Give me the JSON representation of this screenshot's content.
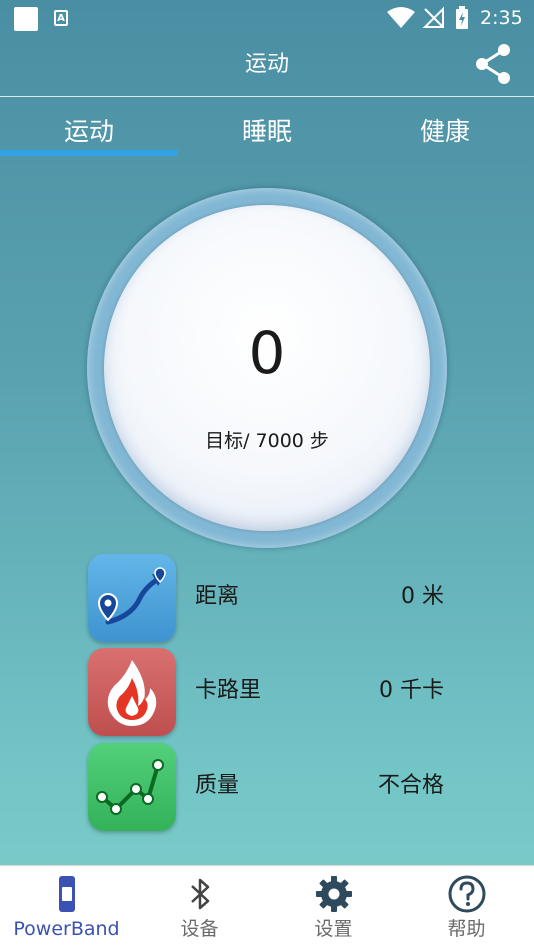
{
  "status_bar": {
    "time": "2:35",
    "a_badge": "A"
  },
  "header": {
    "title": "运动"
  },
  "tabs": [
    {
      "label": "运动",
      "active": true
    },
    {
      "label": "睡眠",
      "active": false
    },
    {
      "label": "健康",
      "active": false
    }
  ],
  "dial": {
    "steps": "0",
    "goal": "目标/ 7000 步"
  },
  "stats": [
    {
      "label": "距离",
      "value": "0 米",
      "icon": "route-icon"
    },
    {
      "label": "卡路里",
      "value": "0 千卡",
      "icon": "flame-icon"
    },
    {
      "label": "质量",
      "value": "不合格",
      "icon": "trend-chart-icon"
    }
  ],
  "bottom_nav": [
    {
      "label": "PowerBand",
      "icon": "band-icon",
      "active": true
    },
    {
      "label": "设备",
      "icon": "bluetooth-icon",
      "active": false
    },
    {
      "label": "设置",
      "icon": "gear-icon",
      "active": false
    },
    {
      "label": "帮助",
      "icon": "help-icon",
      "active": false
    }
  ],
  "colors": {
    "tab_indicator": "#2fa3e6",
    "nav_active": "#3b52b4",
    "distance_tile": "#4fa6dc",
    "calorie_tile": "#cc5f5f",
    "quality_tile": "#45c46a"
  }
}
